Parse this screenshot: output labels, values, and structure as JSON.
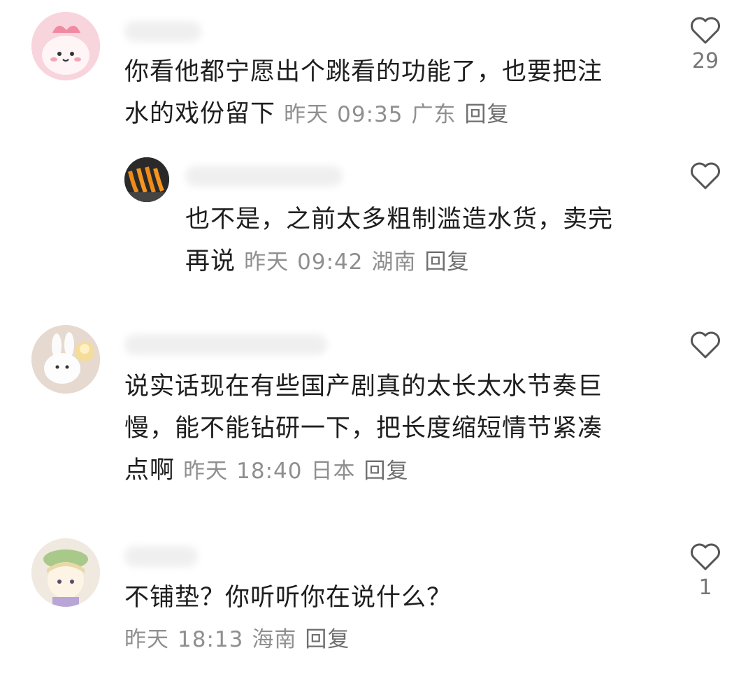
{
  "comments": [
    {
      "lines": [
        "你看他都宁愿出个跳看的功能了，也要把注",
        "水的戏份留下"
      ],
      "meta": {
        "date": "昨天",
        "time": "09:35",
        "location": "广东",
        "reply": "回复"
      },
      "likes": "29"
    },
    {
      "lines": [
        "也不是，之前太多粗制滥造水货，卖完",
        "再说"
      ],
      "meta": {
        "date": "昨天",
        "time": "09:42",
        "location": "湖南",
        "reply": "回复"
      },
      "likes": ""
    },
    {
      "lines": [
        "说实话现在有些国产剧真的太长太水节奏巨",
        "慢，能不能钻研一下，把长度缩短情节紧凑",
        "点啊"
      ],
      "meta": {
        "date": "昨天",
        "time": "18:40",
        "location": "日本",
        "reply": "回复"
      },
      "likes": ""
    },
    {
      "lines": [
        "不铺垫？你听听你在说什么？"
      ],
      "meta": {
        "date": "昨天",
        "time": "18:13",
        "location": "海南",
        "reply": "回复"
      },
      "likes": "1"
    }
  ],
  "icons": {
    "like": "heart-icon"
  },
  "colors": {
    "text": "#1e1e1e",
    "meta": "#8f8f8f",
    "icon": "#555555"
  }
}
